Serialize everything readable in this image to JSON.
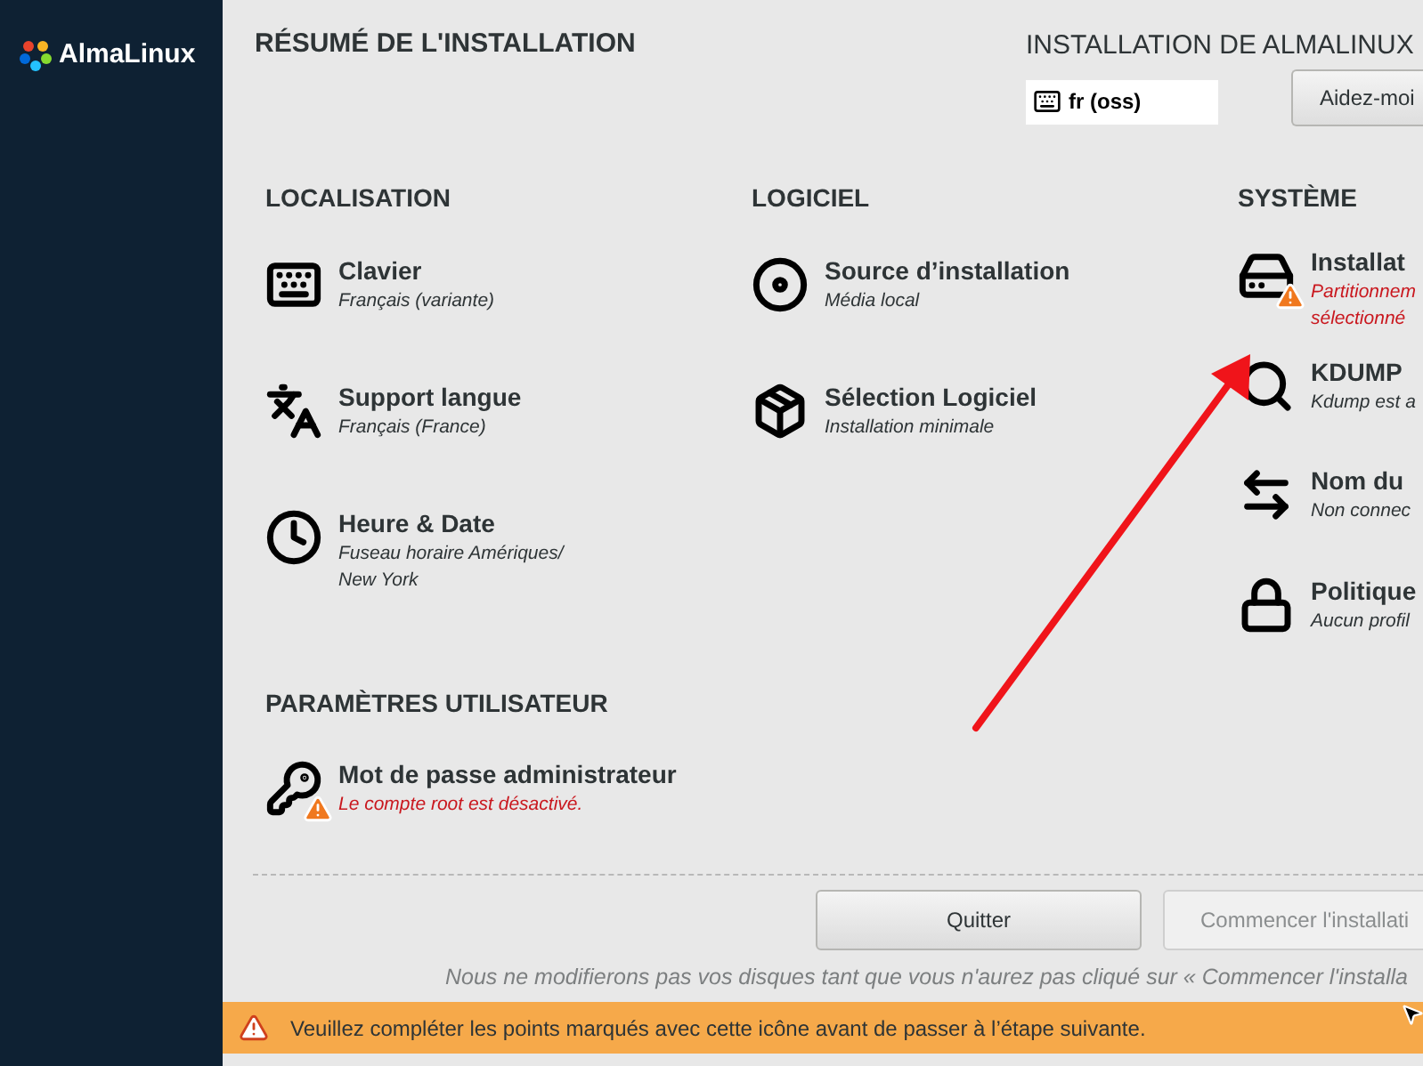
{
  "sidebar": {
    "logo": "AlmaLinux"
  },
  "header": {
    "title": "RÉSUMÉ DE L'INSTALLATION",
    "product": "INSTALLATION DE ALMALINUX",
    "keyboard_layout": "fr (oss)",
    "help_button": "Aidez-moi"
  },
  "sections": [
    {
      "title": "LOCALISATION",
      "items": [
        {
          "kind": "keyboard",
          "title": "Clavier",
          "status": "Français (variante)",
          "warning": false
        },
        {
          "kind": "language",
          "title": "Support langue",
          "status": "Français (France)",
          "warning": false
        },
        {
          "kind": "clock",
          "title": "Heure & Date",
          "status": "Fuseau horaire Amériques/\nNew York",
          "warning": false
        }
      ]
    },
    {
      "title": "LOGICIEL",
      "items": [
        {
          "kind": "disc",
          "title": "Source d’installation",
          "status": "Média local",
          "warning": false
        },
        {
          "kind": "package",
          "title": "Sélection Logiciel",
          "status": "Installation minimale",
          "warning": false
        }
      ]
    },
    {
      "title": "SYSTÈME",
      "items": [
        {
          "kind": "disk",
          "title": "Installat",
          "status": "Partitionnem\nsélectionné",
          "warning": true
        },
        {
          "kind": "search",
          "title": "KDUMP",
          "status": "Kdump est a",
          "warning": false
        },
        {
          "kind": "network",
          "title": "Nom du",
          "status": "Non connec",
          "warning": false
        },
        {
          "kind": "lock",
          "title": "Politique",
          "status": "Aucun profil",
          "warning": false
        }
      ]
    }
  ],
  "user_settings": {
    "title": "PARAMÈTRES UTILISATEUR",
    "items": [
      {
        "kind": "key",
        "title": "Mot de passe administrateur",
        "status": "Le compte root est désactivé.",
        "warning": true
      }
    ]
  },
  "buttons": [
    {
      "label": "Quitter",
      "disabled": false
    },
    {
      "label": "Commencer l'installati",
      "disabled": true
    }
  ],
  "note": "Nous ne modifierons pas vos disques tant que vous n'aurez pas cliqué sur « Commencer l'installa",
  "warning_bar": {
    "text": "Veuillez compléter les points marqués avec cette icône avant de passer à l’étape suivante."
  }
}
